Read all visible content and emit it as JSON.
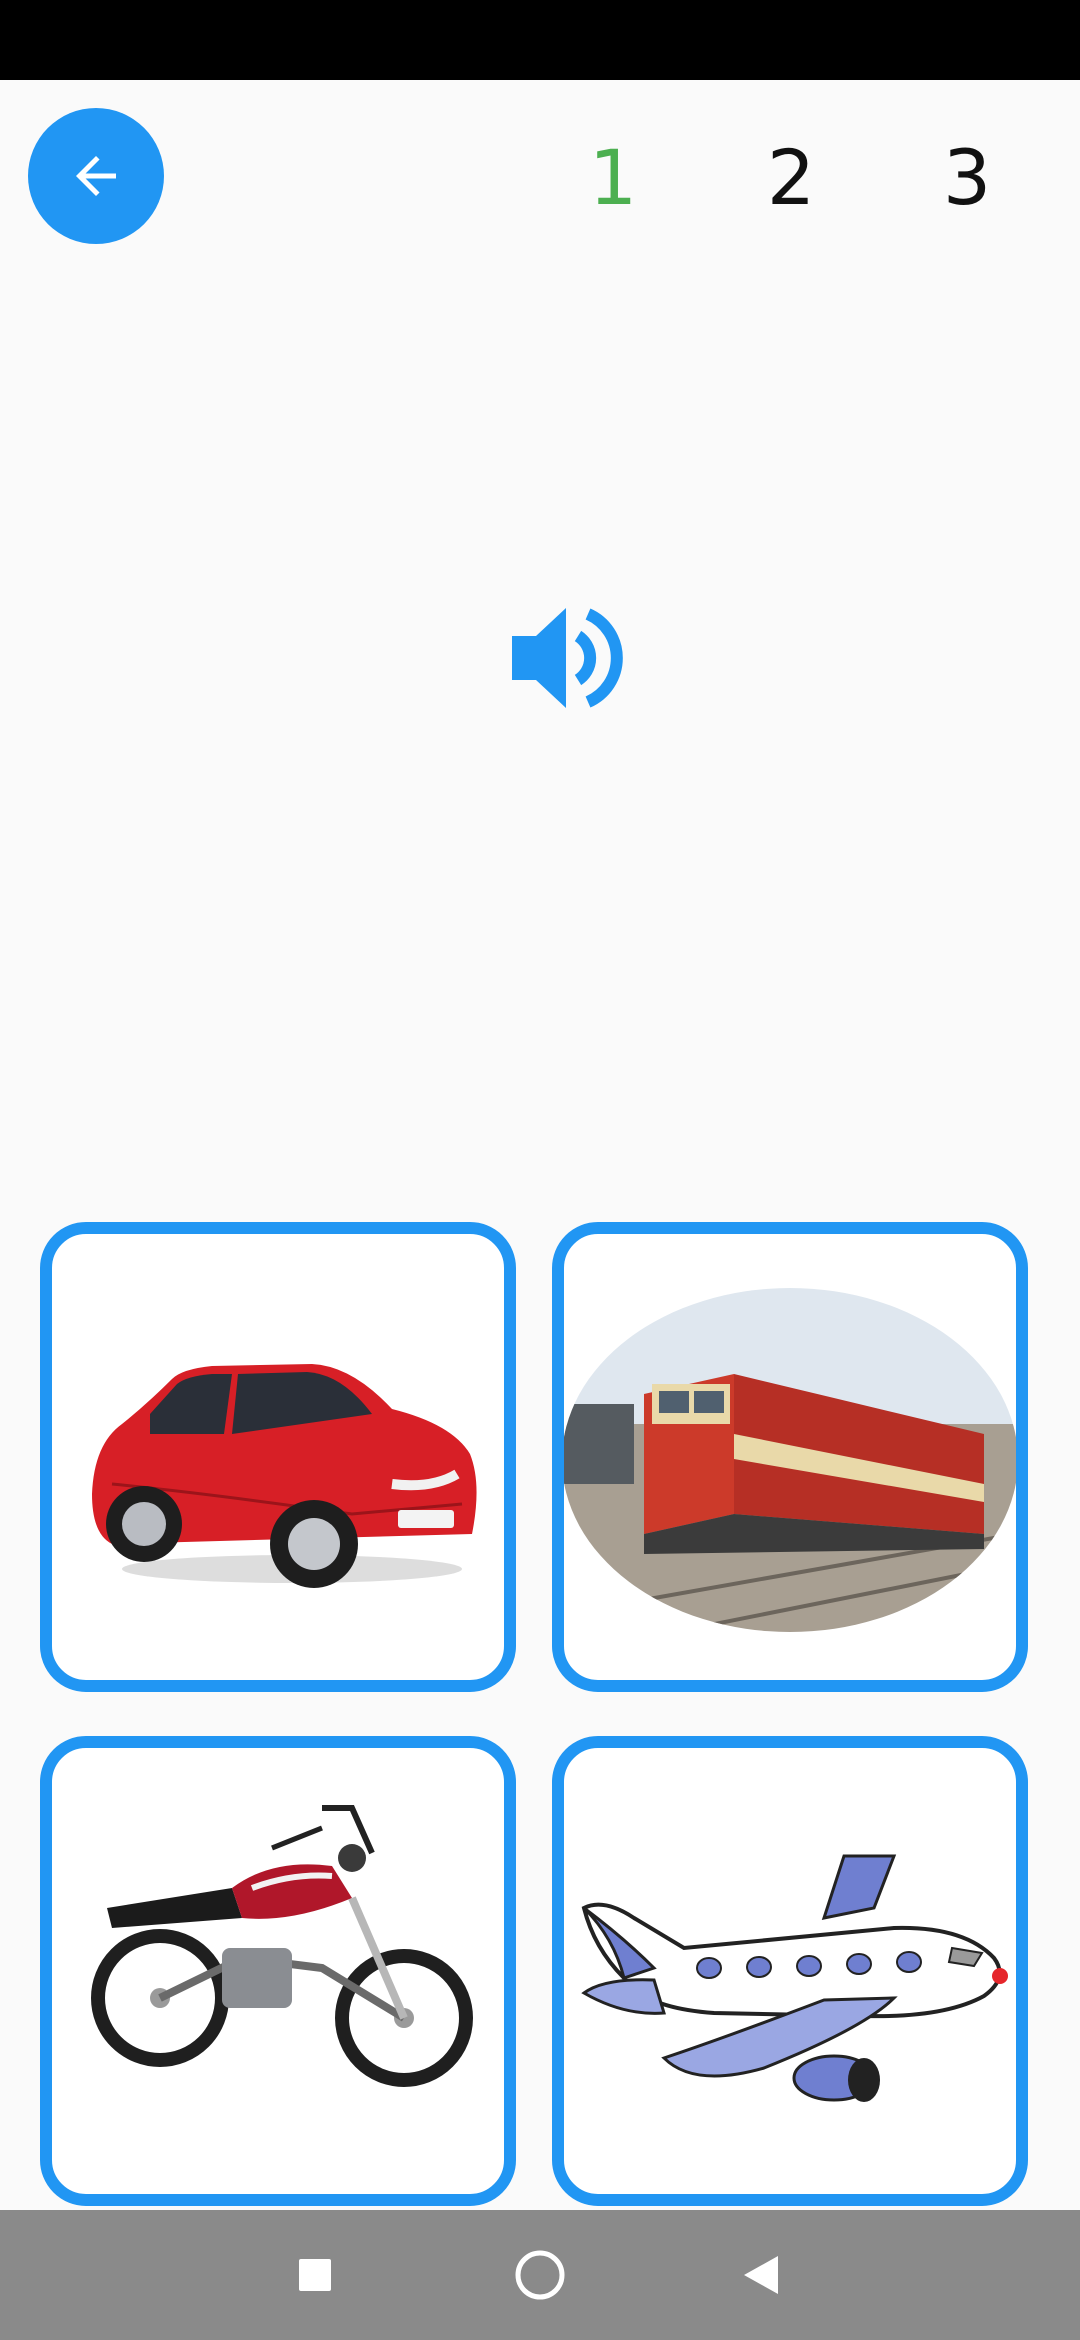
{
  "header": {
    "back_icon": "arrow-left-icon",
    "steps": [
      {
        "label": "1",
        "state": "active",
        "color": "#4caf50"
      },
      {
        "label": "2",
        "state": "inactive",
        "color": "#111111"
      },
      {
        "label": "3",
        "state": "inactive",
        "color": "#111111"
      }
    ]
  },
  "prompt": {
    "icon": "speaker-icon",
    "color": "#2196f3"
  },
  "choices": [
    {
      "name": "car",
      "image": "red-car-image"
    },
    {
      "name": "train",
      "image": "train-image"
    },
    {
      "name": "motorcycle",
      "image": "motorcycle-image"
    },
    {
      "name": "airplane",
      "image": "airplane-image"
    }
  ],
  "theme": {
    "accent": "#2196f3",
    "background": "#fafafa"
  },
  "navigation": {
    "icons": [
      "recent-apps-icon",
      "home-icon",
      "back-icon"
    ]
  }
}
